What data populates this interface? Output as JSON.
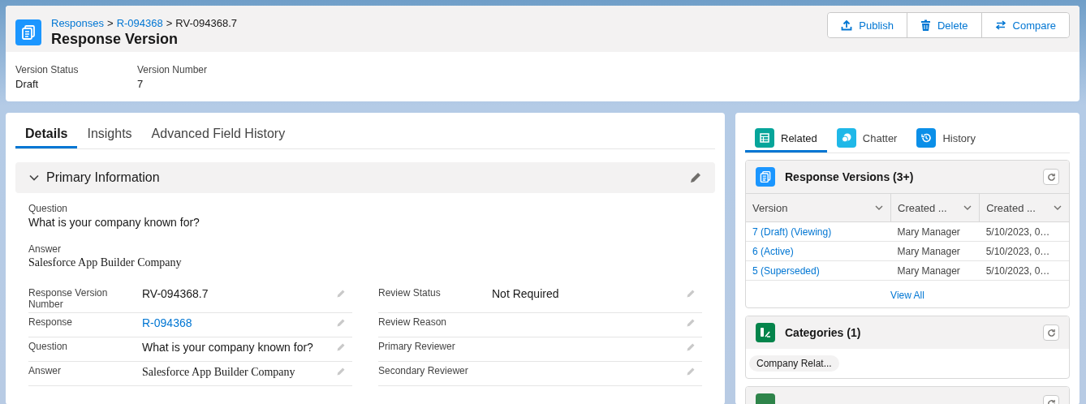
{
  "header": {
    "breadcrumb": [
      {
        "text": "Responses",
        "kind": "link"
      },
      {
        "text": "R-094368",
        "kind": "link"
      },
      {
        "text": "RV-094368.7",
        "kind": "current"
      }
    ],
    "separator": ">",
    "title": "Response Version",
    "actions": [
      {
        "label": "Publish"
      },
      {
        "label": "Delete"
      },
      {
        "label": "Compare"
      }
    ],
    "highlights": [
      {
        "label": "Version Status",
        "value": "Draft"
      },
      {
        "label": "Version Number",
        "value": "7"
      }
    ]
  },
  "detail_tabs": [
    {
      "label": "Details",
      "selected": true
    },
    {
      "label": "Insights",
      "selected": false
    },
    {
      "label": "Advanced Field History",
      "selected": false
    }
  ],
  "section": {
    "title": "Primary Information",
    "expanded": true,
    "stacked_fields": [
      {
        "label": "Question",
        "value": "What is your company known for?",
        "kind": "text"
      },
      {
        "label": "Answer",
        "value": "Salesforce App Builder Company",
        "kind": "rich_text"
      }
    ],
    "field_rows": [
      [
        {
          "label": "Response Version Number",
          "value": "RV-094368.7",
          "kind": "text"
        },
        {
          "label": "Review Status",
          "value": "Not Required",
          "kind": "text"
        }
      ],
      [
        {
          "label": "Response",
          "value": "R-094368",
          "kind": "link"
        },
        {
          "label": "Review Reason"
        }
      ],
      [
        {
          "label": "Question",
          "value": "What is your company known for?",
          "kind": "text"
        },
        {
          "label": "Primary Reviewer"
        }
      ],
      [
        {
          "label": "Answer",
          "value": "Salesforce App Builder Company",
          "kind": "rich_text"
        },
        {
          "label": "Secondary Reviewer"
        }
      ]
    ]
  },
  "related_tabs": [
    {
      "label": "Related",
      "selected": true
    },
    {
      "label": "Chatter",
      "selected": false
    },
    {
      "label": "History",
      "selected": false
    }
  ],
  "related_lists": [
    {
      "kind": "table",
      "title": "Response Versions (3+)",
      "columns": [
        "Version",
        "Created ...",
        "Created ..."
      ],
      "rows": [
        [
          "7 (Draft) (Viewing)",
          "Mary Manager",
          "5/10/2023, 0…"
        ],
        [
          "6 (Active)",
          "Mary Manager",
          "5/10/2023, 0…"
        ],
        [
          "5 (Superseded)",
          "Mary Manager",
          "5/10/2023, 0…"
        ]
      ],
      "footer": "View All"
    },
    {
      "kind": "pills",
      "title": "Categories (1)",
      "pills": [
        "Company Relat..."
      ]
    },
    {
      "kind": "stub"
    }
  ]
}
